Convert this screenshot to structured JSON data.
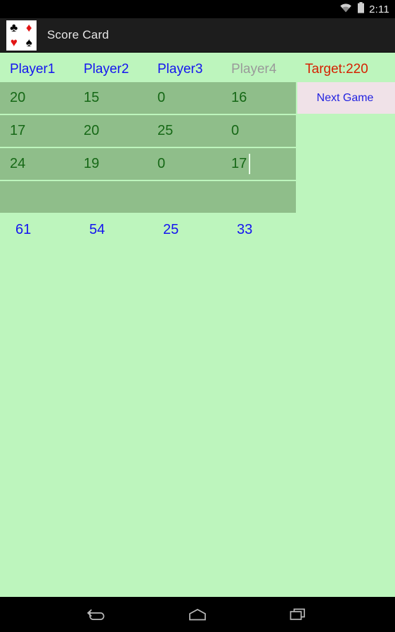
{
  "status_bar": {
    "time": "2:11",
    "wifi_icon": "wifi-icon",
    "battery_icon": "battery-full-icon"
  },
  "action_bar": {
    "title": "Score Card",
    "icon": "playing-card-suits-icon",
    "suits": [
      "♣",
      "♦",
      "♥",
      "♠"
    ]
  },
  "colors": {
    "page_background": "#bdf5bd",
    "row_background": "#8fbe8a",
    "player_name": "#1414f0",
    "player_inactive": "#9a9a9a",
    "target_text": "#d62000",
    "score_text": "#166816",
    "total_text": "#1414f0",
    "button_background": "#f0e2e8",
    "button_text": "#2222e0",
    "action_bar": "#1d1d1d"
  },
  "scorecard": {
    "columns": [
      {
        "label": "Player1",
        "active": true
      },
      {
        "label": "Player2",
        "active": true
      },
      {
        "label": "Player3",
        "active": true
      },
      {
        "label": "Player4",
        "active": false
      }
    ],
    "target_label": "Target:220",
    "target_value": "220",
    "rows": [
      {
        "values": [
          "20",
          "15",
          "0",
          "16"
        ],
        "focused_col": -1
      },
      {
        "values": [
          "17",
          "20",
          "25",
          "0"
        ],
        "focused_col": -1
      },
      {
        "values": [
          "24",
          "19",
          "0",
          "17"
        ],
        "focused_col": 3
      },
      {
        "values": [
          "",
          "",
          "",
          ""
        ],
        "focused_col": -1
      }
    ],
    "totals": [
      "61",
      "54",
      "25",
      "33"
    ]
  },
  "next_game_button": {
    "label": "Next Game"
  },
  "nav_bar": {
    "back": "back-icon",
    "home": "home-icon",
    "recents": "recents-icon"
  }
}
